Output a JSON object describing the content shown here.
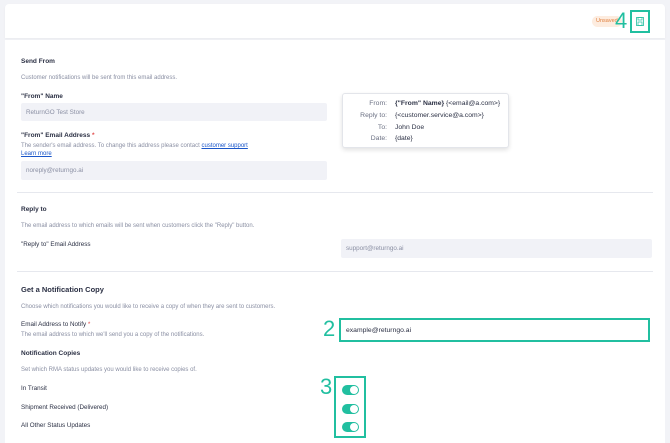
{
  "header": {
    "unsaved_label": "Unsaved",
    "step4": "4"
  },
  "send_from": {
    "title": "Send From",
    "description": "Customer notifications will be sent from this email address.",
    "from_name_label": "\"From\" Name",
    "from_name_value": "ReturnGO Test Store",
    "from_email_label": "\"From\" Email Address",
    "required_mark": "*",
    "from_email_help": "The sender's email address. To change this address please contact",
    "support_link": "customer support",
    "learn_more": "Learn more",
    "from_email_value": "noreply@returngo.ai"
  },
  "preview": {
    "rows": [
      {
        "key": "From:",
        "value_bold": "{\"From\" Name}",
        "value": "{<email@a.com>}"
      },
      {
        "key": "Reply to:",
        "value_bold": "",
        "value": "{<customer.service@a.com>}"
      },
      {
        "key": "To:",
        "value_bold": "",
        "value": "John Doe"
      },
      {
        "key": "Date:",
        "value_bold": "",
        "value": "{date}"
      }
    ]
  },
  "reply_to": {
    "title": "Reply to",
    "description": "The email address to which emails will be sent when customers click the \"Reply\" button.",
    "field_label": "\"Reply to\" Email Address",
    "field_value": "support@returngo.ai"
  },
  "notification_copy": {
    "title": "Get a Notification Copy",
    "description": "Choose which notifications you would like to receive a copy of when they are sent to customers.",
    "notify_label": "Email Address to Notify",
    "required_mark": "*",
    "notify_help": "The email address to which we'll send you a copy of the notifications.",
    "notify_value": "example@returngo.ai",
    "step2": "2",
    "copies_title": "Notification Copies",
    "copies_description": "Set which RMA status updates you would like to receive copies of.",
    "step3": "3",
    "toggles": [
      {
        "label": "In Transit",
        "on": true
      },
      {
        "label": "Shipment Received (Delivered)",
        "on": true
      },
      {
        "label": "All Other Status Updates",
        "on": true
      }
    ]
  },
  "colors": {
    "accent": "#21bfa0",
    "badge_bg": "#fdecdf",
    "badge_text": "#e0803f",
    "link": "#1a56c9"
  }
}
